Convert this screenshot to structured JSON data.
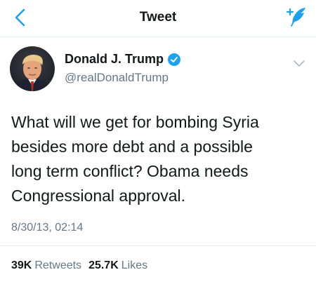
{
  "nav": {
    "title": "Tweet",
    "back_icon": "chevron-left-icon",
    "compose_icon": "compose-feather-icon"
  },
  "author": {
    "display_name": "Donald J. Trump",
    "handle": "@realDonaldTrump",
    "verified": true
  },
  "tweet": {
    "text_lines": [
      "What will we get for bombing Syria",
      "besides more debt and a possible",
      "long term conflict? Obama needs",
      "Congressional approval."
    ],
    "timestamp": "8/30/13, 02:14"
  },
  "stats": {
    "retweets_count": "39K",
    "retweets_label": "Retweets",
    "likes_count": "25.7K",
    "likes_label": "Likes"
  },
  "colors": {
    "accent": "#1da1f2",
    "secondary_text": "#657786",
    "primary_text": "#14171a",
    "divider": "#e6ecf0"
  }
}
